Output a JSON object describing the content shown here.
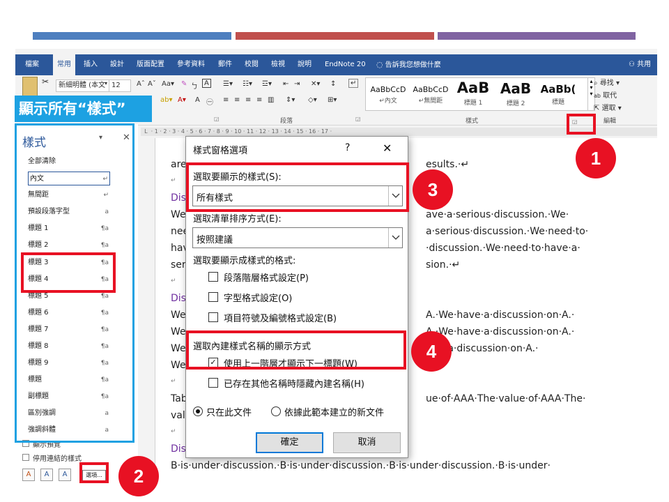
{
  "colors": {
    "bar_blue": "#4e7fbf",
    "bar_red": "#c0504d",
    "bar_purple": "#8064a2",
    "ribbon": "#2b579a",
    "annotation_red": "#e81123",
    "annotation_blue": "#1da1e2"
  },
  "ribbon": {
    "tabs": [
      "檔案",
      "常用",
      "插入",
      "設計",
      "版面配置",
      "參考資料",
      "郵件",
      "校閱",
      "檢視",
      "說明",
      "EndNote 20"
    ],
    "tell_me": "告訴我您想做什麼",
    "share": "共用",
    "font_name": "新細明體 (本文",
    "font_size": "12",
    "style_gallery": [
      {
        "sample": "AaBbCcD",
        "name": "↵內文"
      },
      {
        "sample": "AaBbCcD",
        "name": "↵無間距"
      },
      {
        "sample": "AaB",
        "name": "標題 1"
      },
      {
        "sample": "AaB",
        "name": "標題 2"
      },
      {
        "sample": "AaBb(",
        "name": "標題"
      }
    ],
    "editing": {
      "find": "尋找",
      "replace": "取代",
      "select": "選取"
    },
    "groups": {
      "paragraph": "段落",
      "styles": "樣式",
      "editing": "編輯"
    }
  },
  "annotation": {
    "title": "顯示所有“樣式”"
  },
  "badges": [
    "1",
    "2",
    "3",
    "4"
  ],
  "styles_pane": {
    "title": "樣式",
    "items": [
      {
        "label": "全部清除",
        "mark": ""
      },
      {
        "label": "內文",
        "mark": "↵"
      },
      {
        "label": "無間距",
        "mark": "↵"
      },
      {
        "label": "預設段落字型",
        "mark": "a"
      },
      {
        "label": "標題 1",
        "mark": "¶a"
      },
      {
        "label": "標題 2",
        "mark": "¶a"
      },
      {
        "label": "標題 3",
        "mark": "¶a"
      },
      {
        "label": "標題 4",
        "mark": "¶a"
      },
      {
        "label": "標題 5",
        "mark": "¶a"
      },
      {
        "label": "標題 6",
        "mark": "¶a"
      },
      {
        "label": "標題 7",
        "mark": "¶a"
      },
      {
        "label": "標題 8",
        "mark": "¶a"
      },
      {
        "label": "標題 9",
        "mark": "¶a"
      },
      {
        "label": "標題",
        "mark": "¶a"
      },
      {
        "label": "副標題",
        "mark": "¶a"
      },
      {
        "label": "區別強調",
        "mark": "a"
      },
      {
        "label": "強調斜體",
        "mark": "a"
      }
    ],
    "show_preview": "顯示預覽",
    "disable_linked": "停用連結的樣式",
    "options_button": "選項..."
  },
  "document": {
    "lines": [
      {
        "text": "are",
        "heading": false
      },
      {
        "text": "↵",
        "heading": false
      },
      {
        "text": "Dis",
        "heading": true
      },
      {
        "text": "We",
        "heading": false
      },
      {
        "text": "nee",
        "heading": false
      },
      {
        "text": "hav",
        "heading": false
      },
      {
        "text": "seri",
        "heading": false
      },
      {
        "text": "↵",
        "heading": false
      },
      {
        "text": "Dis",
        "heading": true
      },
      {
        "text": "We",
        "heading": false
      },
      {
        "text": "We",
        "heading": false
      },
      {
        "text": "We",
        "heading": false
      },
      {
        "text": "We",
        "heading": false
      },
      {
        "text": "↵",
        "heading": false
      },
      {
        "text": "Tab",
        "heading": false
      },
      {
        "text": "valu",
        "heading": false
      },
      {
        "text": "↵",
        "heading": false
      },
      {
        "text": "Dis",
        "heading": true
      },
      {
        "text": "B·is·under·discussion.·B·is·under·discussion.·B·is·under·discussion.·B·is·under·",
        "heading": false
      }
    ],
    "right_fragments": [
      "esults.·↵",
      "ave·a·serious·discussion.·We·",
      "a·serious·discussion.·We·need·to·",
      "·discussion.·We·need·to·have·a·",
      "sion.·↵",
      "A.·We·have·a·discussion·on·A.·",
      "A.·We·have·a·discussion·on·A.·",
      "ve·a·discussion·on·A.·",
      "ue·of·AAA·The·value·of·AAA·The·"
    ]
  },
  "dialog": {
    "title": "樣式窗格選項",
    "help": "?",
    "close": "✕",
    "select_styles_label": "選取要顯示的樣式(S):",
    "select_styles_value": "所有樣式",
    "sort_label": "選取清單排序方式(E):",
    "sort_value": "按照建議",
    "format_label": "選取要顯示成樣式的格式:",
    "format_options": [
      {
        "label": "段落階層格式設定(P)",
        "checked": false
      },
      {
        "label": "字型格式設定(O)",
        "checked": false
      },
      {
        "label": "項目符號及編號格式設定(B)",
        "checked": false
      }
    ],
    "builtin_label": "選取內建樣式名稱的顯示方式",
    "builtin_options": [
      {
        "label": "使用上一階層才顯示下一標題(W)",
        "checked": true
      },
      {
        "label": "已存在其他名稱時隱藏內建名稱(H)",
        "checked": false
      }
    ],
    "scope_options": [
      {
        "label": "只在此文件",
        "selected": true
      },
      {
        "label": "依據此範本建立的新文件",
        "selected": false
      }
    ],
    "ok": "確定",
    "cancel": "取消"
  }
}
